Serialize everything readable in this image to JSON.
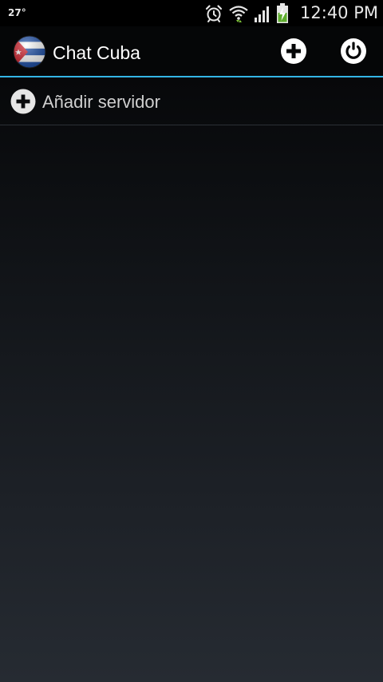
{
  "status_bar": {
    "temperature": "27°",
    "time": "12:40 PM",
    "icons": [
      "alarm-icon",
      "wifi-icon",
      "signal-icon",
      "battery-charging-icon"
    ]
  },
  "action_bar": {
    "title": "Chat Cuba",
    "logo_icon": "cuba-flag-icon",
    "actions": [
      "add-circle-icon",
      "power-icon"
    ],
    "accent_color": "#33b5e5"
  },
  "list": {
    "items": [
      {
        "label": "Añadir servidor",
        "icon": "add-circle-icon"
      }
    ]
  }
}
